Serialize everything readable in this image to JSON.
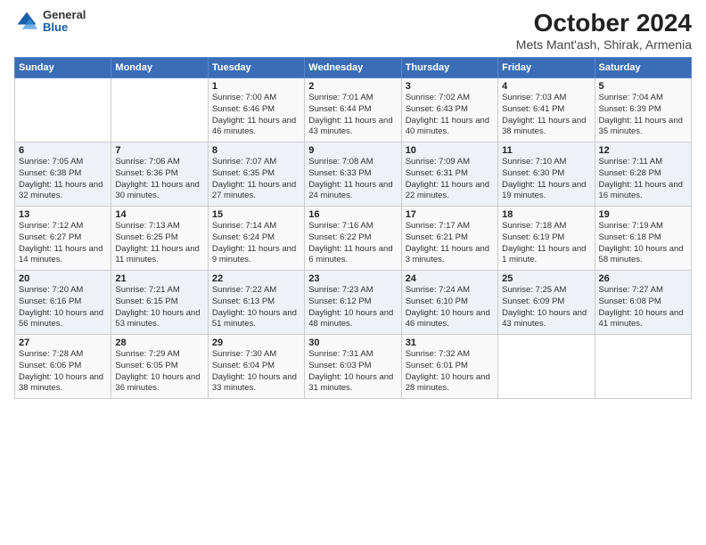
{
  "header": {
    "logo": {
      "general": "General",
      "blue": "Blue"
    },
    "title": "October 2024",
    "subtitle": "Mets Mant'ash, Shirak, Armenia"
  },
  "weekdays": [
    "Sunday",
    "Monday",
    "Tuesday",
    "Wednesday",
    "Thursday",
    "Friday",
    "Saturday"
  ],
  "weeks": [
    [
      {
        "day": "",
        "sunrise": "",
        "sunset": "",
        "daylight": ""
      },
      {
        "day": "",
        "sunrise": "",
        "sunset": "",
        "daylight": ""
      },
      {
        "day": "1",
        "sunrise": "Sunrise: 7:00 AM",
        "sunset": "Sunset: 6:46 PM",
        "daylight": "Daylight: 11 hours and 46 minutes."
      },
      {
        "day": "2",
        "sunrise": "Sunrise: 7:01 AM",
        "sunset": "Sunset: 6:44 PM",
        "daylight": "Daylight: 11 hours and 43 minutes."
      },
      {
        "day": "3",
        "sunrise": "Sunrise: 7:02 AM",
        "sunset": "Sunset: 6:43 PM",
        "daylight": "Daylight: 11 hours and 40 minutes."
      },
      {
        "day": "4",
        "sunrise": "Sunrise: 7:03 AM",
        "sunset": "Sunset: 6:41 PM",
        "daylight": "Daylight: 11 hours and 38 minutes."
      },
      {
        "day": "5",
        "sunrise": "Sunrise: 7:04 AM",
        "sunset": "Sunset: 6:39 PM",
        "daylight": "Daylight: 11 hours and 35 minutes."
      }
    ],
    [
      {
        "day": "6",
        "sunrise": "Sunrise: 7:05 AM",
        "sunset": "Sunset: 6:38 PM",
        "daylight": "Daylight: 11 hours and 32 minutes."
      },
      {
        "day": "7",
        "sunrise": "Sunrise: 7:06 AM",
        "sunset": "Sunset: 6:36 PM",
        "daylight": "Daylight: 11 hours and 30 minutes."
      },
      {
        "day": "8",
        "sunrise": "Sunrise: 7:07 AM",
        "sunset": "Sunset: 6:35 PM",
        "daylight": "Daylight: 11 hours and 27 minutes."
      },
      {
        "day": "9",
        "sunrise": "Sunrise: 7:08 AM",
        "sunset": "Sunset: 6:33 PM",
        "daylight": "Daylight: 11 hours and 24 minutes."
      },
      {
        "day": "10",
        "sunrise": "Sunrise: 7:09 AM",
        "sunset": "Sunset: 6:31 PM",
        "daylight": "Daylight: 11 hours and 22 minutes."
      },
      {
        "day": "11",
        "sunrise": "Sunrise: 7:10 AM",
        "sunset": "Sunset: 6:30 PM",
        "daylight": "Daylight: 11 hours and 19 minutes."
      },
      {
        "day": "12",
        "sunrise": "Sunrise: 7:11 AM",
        "sunset": "Sunset: 6:28 PM",
        "daylight": "Daylight: 11 hours and 16 minutes."
      }
    ],
    [
      {
        "day": "13",
        "sunrise": "Sunrise: 7:12 AM",
        "sunset": "Sunset: 6:27 PM",
        "daylight": "Daylight: 11 hours and 14 minutes."
      },
      {
        "day": "14",
        "sunrise": "Sunrise: 7:13 AM",
        "sunset": "Sunset: 6:25 PM",
        "daylight": "Daylight: 11 hours and 11 minutes."
      },
      {
        "day": "15",
        "sunrise": "Sunrise: 7:14 AM",
        "sunset": "Sunset: 6:24 PM",
        "daylight": "Daylight: 11 hours and 9 minutes."
      },
      {
        "day": "16",
        "sunrise": "Sunrise: 7:16 AM",
        "sunset": "Sunset: 6:22 PM",
        "daylight": "Daylight: 11 hours and 6 minutes."
      },
      {
        "day": "17",
        "sunrise": "Sunrise: 7:17 AM",
        "sunset": "Sunset: 6:21 PM",
        "daylight": "Daylight: 11 hours and 3 minutes."
      },
      {
        "day": "18",
        "sunrise": "Sunrise: 7:18 AM",
        "sunset": "Sunset: 6:19 PM",
        "daylight": "Daylight: 11 hours and 1 minute."
      },
      {
        "day": "19",
        "sunrise": "Sunrise: 7:19 AM",
        "sunset": "Sunset: 6:18 PM",
        "daylight": "Daylight: 10 hours and 58 minutes."
      }
    ],
    [
      {
        "day": "20",
        "sunrise": "Sunrise: 7:20 AM",
        "sunset": "Sunset: 6:16 PM",
        "daylight": "Daylight: 10 hours and 56 minutes."
      },
      {
        "day": "21",
        "sunrise": "Sunrise: 7:21 AM",
        "sunset": "Sunset: 6:15 PM",
        "daylight": "Daylight: 10 hours and 53 minutes."
      },
      {
        "day": "22",
        "sunrise": "Sunrise: 7:22 AM",
        "sunset": "Sunset: 6:13 PM",
        "daylight": "Daylight: 10 hours and 51 minutes."
      },
      {
        "day": "23",
        "sunrise": "Sunrise: 7:23 AM",
        "sunset": "Sunset: 6:12 PM",
        "daylight": "Daylight: 10 hours and 48 minutes."
      },
      {
        "day": "24",
        "sunrise": "Sunrise: 7:24 AM",
        "sunset": "Sunset: 6:10 PM",
        "daylight": "Daylight: 10 hours and 46 minutes."
      },
      {
        "day": "25",
        "sunrise": "Sunrise: 7:25 AM",
        "sunset": "Sunset: 6:09 PM",
        "daylight": "Daylight: 10 hours and 43 minutes."
      },
      {
        "day": "26",
        "sunrise": "Sunrise: 7:27 AM",
        "sunset": "Sunset: 6:08 PM",
        "daylight": "Daylight: 10 hours and 41 minutes."
      }
    ],
    [
      {
        "day": "27",
        "sunrise": "Sunrise: 7:28 AM",
        "sunset": "Sunset: 6:06 PM",
        "daylight": "Daylight: 10 hours and 38 minutes."
      },
      {
        "day": "28",
        "sunrise": "Sunrise: 7:29 AM",
        "sunset": "Sunset: 6:05 PM",
        "daylight": "Daylight: 10 hours and 36 minutes."
      },
      {
        "day": "29",
        "sunrise": "Sunrise: 7:30 AM",
        "sunset": "Sunset: 6:04 PM",
        "daylight": "Daylight: 10 hours and 33 minutes."
      },
      {
        "day": "30",
        "sunrise": "Sunrise: 7:31 AM",
        "sunset": "Sunset: 6:03 PM",
        "daylight": "Daylight: 10 hours and 31 minutes."
      },
      {
        "day": "31",
        "sunrise": "Sunrise: 7:32 AM",
        "sunset": "Sunset: 6:01 PM",
        "daylight": "Daylight: 10 hours and 28 minutes."
      },
      {
        "day": "",
        "sunrise": "",
        "sunset": "",
        "daylight": ""
      },
      {
        "day": "",
        "sunrise": "",
        "sunset": "",
        "daylight": ""
      }
    ]
  ]
}
